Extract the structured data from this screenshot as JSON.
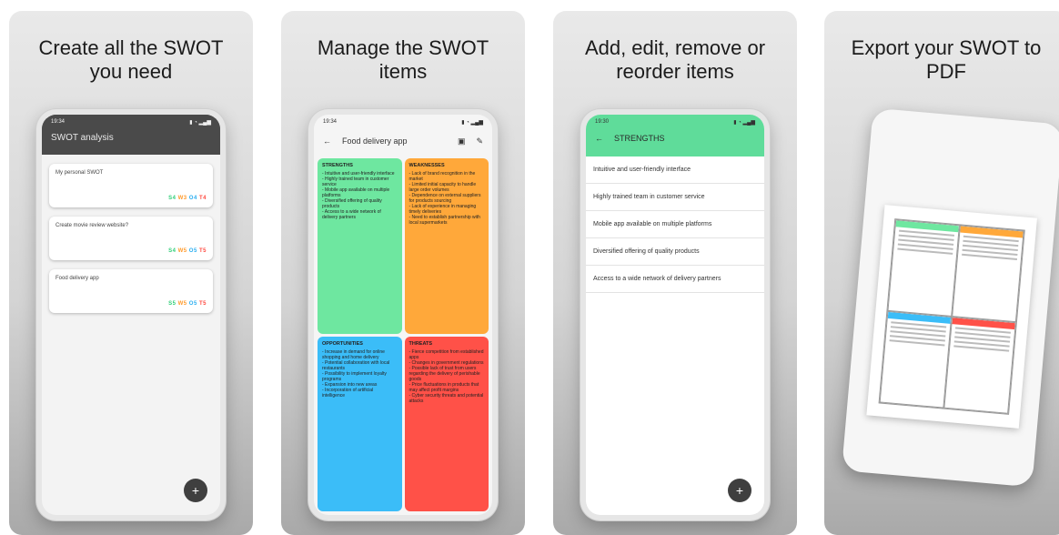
{
  "panels": [
    {
      "title": "Create all the SWOT you need"
    },
    {
      "title": "Manage the SWOT items"
    },
    {
      "title": "Add, edit, remove or reorder items"
    },
    {
      "title": "Export your SWOT to PDF"
    }
  ],
  "status": {
    "time": "19:34",
    "time2": "19:30"
  },
  "screen1": {
    "app_title": "SWOT analysis",
    "cards": [
      {
        "name": "My personal SWOT",
        "counts": "S4 W3 O4 T4"
      },
      {
        "name": "Create movie review website?",
        "counts": "S4 W5 O5 T5"
      },
      {
        "name": "Food delivery app",
        "counts": "S5 W5 O5 T5"
      }
    ],
    "fab": "+"
  },
  "screen2": {
    "title": "Food delivery app",
    "strengths": {
      "header": "STRENGTHS",
      "items": [
        "- Intuitive and user-friendly interface",
        "- Highly trained team in customer service",
        "- Mobile app available on multiple platforms",
        "- Diversified offering of quality products",
        "- Access to a wide network of delivery partners"
      ]
    },
    "weaknesses": {
      "header": "WEAKNESSES",
      "items": [
        "- Lack of brand recognition in the market",
        "- Limited initial capacity to handle large order volumes",
        "- Dependence on external suppliers for products sourcing",
        "- Lack of experience in managing timely deliveries",
        "- Need to establish partnership with local supermarkets"
      ]
    },
    "opportunities": {
      "header": "OPPORTUNITIES",
      "items": [
        "- Increase in demand for online shopping and home delivery",
        "- Potential collaboration with local restaurants",
        "- Possibility to implement loyalty programs",
        "- Expansion into new areas",
        "- Incorporation of artificial intelligence"
      ]
    },
    "threats": {
      "header": "THREATS",
      "items": [
        "- Fierce competition from established apps",
        "- Changes in government regulations",
        "- Possible lack of trust from users regarding the delivery of perishable goods",
        "- Price fluctuations in products that may affect profit margins",
        "- Cyber security threats and potential attacks"
      ]
    }
  },
  "screen3": {
    "title": "STRENGTHS",
    "items": [
      "Intuitive and user-friendly interface",
      "Highly trained team in customer service",
      "Mobile app available on multiple platforms",
      "Diversified offering of quality products",
      "Access to a wide network of delivery partners"
    ],
    "fab": "+"
  },
  "colors": {
    "strengths": "#6ee7a0",
    "weaknesses": "#ffa83a",
    "opportunities": "#3bbdf8",
    "threats": "#ff5148",
    "green_bar": "#5fdc9a"
  },
  "icons": [
    "back-arrow-icon",
    "pdf-icon",
    "edit-pencil-icon",
    "plus-icon"
  ]
}
